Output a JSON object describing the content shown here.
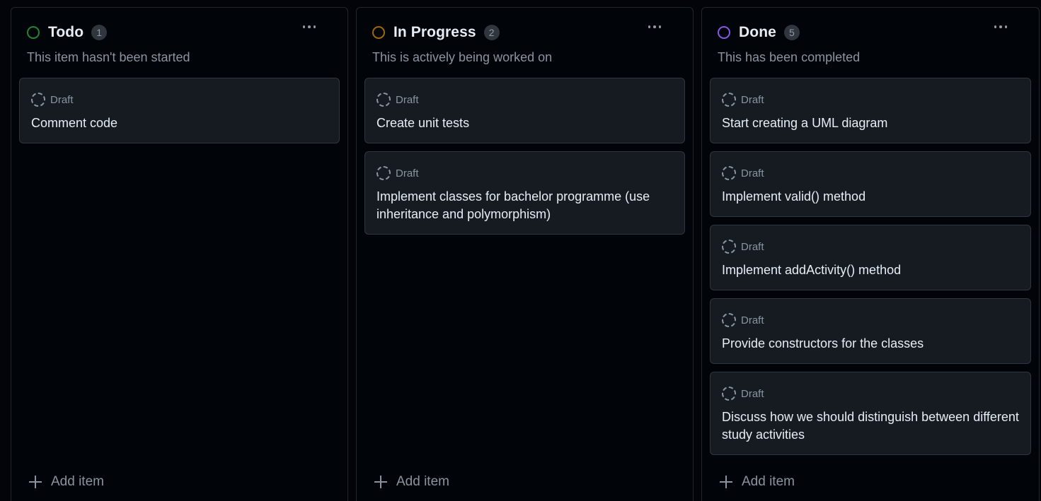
{
  "columns": [
    {
      "title": "Todo",
      "count": "1",
      "description": "This item hasn't been started",
      "status_color": "#238636",
      "cards": [
        {
          "status": "Draft",
          "title": "Comment code"
        }
      ],
      "add_label": "Add item"
    },
    {
      "title": "In Progress",
      "count": "2",
      "description": "This is actively being worked on",
      "status_color": "#9e6a03",
      "cards": [
        {
          "status": "Draft",
          "title": "Create unit tests"
        },
        {
          "status": "Draft",
          "title": "Implement classes for bachelor programme (use inheritance and polymorphism)"
        }
      ],
      "add_label": "Add item"
    },
    {
      "title": "Done",
      "count": "5",
      "description": "This has been completed",
      "status_color": "#8957e5",
      "cards": [
        {
          "status": "Draft",
          "title": "Start creating a UML diagram"
        },
        {
          "status": "Draft",
          "title": "Implement valid() method"
        },
        {
          "status": "Draft",
          "title": "Implement addActivity() method"
        },
        {
          "status": "Draft",
          "title": "Provide constructors for the classes"
        },
        {
          "status": "Draft",
          "title": "Discuss how we should distinguish between different study activities"
        }
      ],
      "add_label": "Add item"
    }
  ]
}
